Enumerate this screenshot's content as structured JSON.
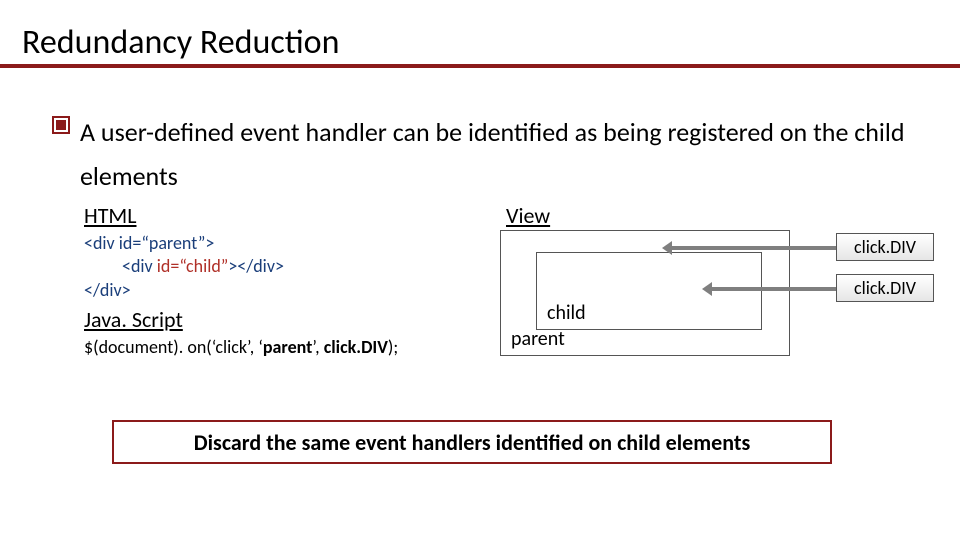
{
  "title": "Redundancy Reduction",
  "bullet": "A user-defined event handler can be identified as being registered on the child elements",
  "labels": {
    "html": "HTML",
    "js": "Java. Script",
    "view": "View",
    "parent": "parent",
    "child": "child"
  },
  "code": {
    "html": {
      "open_parent_a": "<div ",
      "open_parent_id": "id",
      "open_parent_b": "=“parent”",
      "open_parent_c": ">",
      "open_child_a": "<div ",
      "open_child_id": "id",
      "open_child_b": "=“child”",
      "open_child_c": "></div>",
      "close_parent": "</div>"
    },
    "js": {
      "a": "$(document). on(‘click’, ‘",
      "parent": "parent",
      "b": "’, ",
      "handler": "click.DIV",
      "c": ");"
    }
  },
  "btn": "click.DIV",
  "conclusion": "Discard the same event handlers identified on child elements"
}
